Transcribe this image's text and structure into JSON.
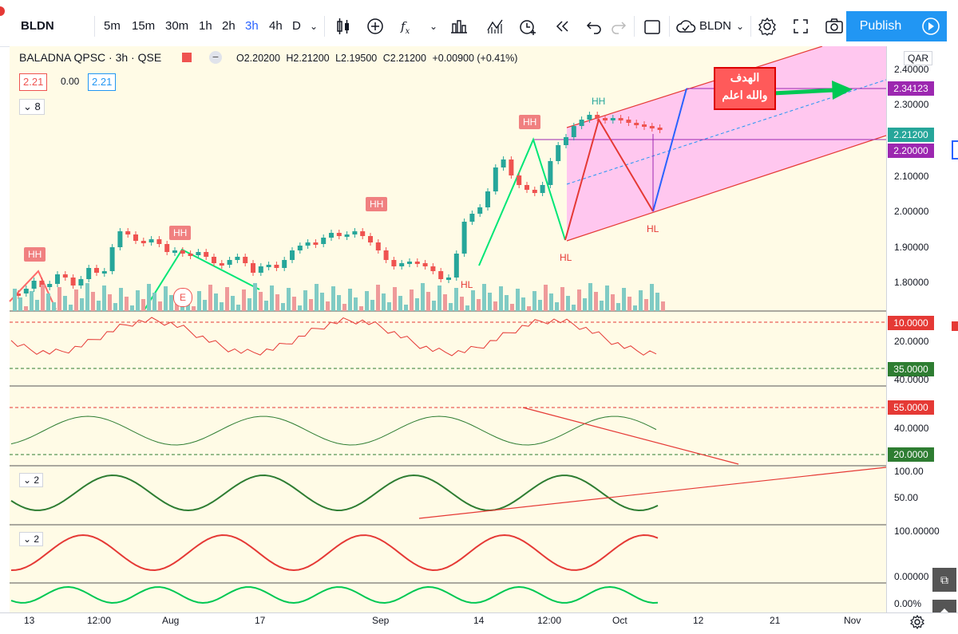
{
  "toolbar": {
    "symbol": "BLDN",
    "intervals": [
      "5m",
      "15m",
      "30m",
      "1h",
      "2h",
      "3h",
      "4h",
      "D"
    ],
    "active_interval": "3h",
    "compare_symbol": "BLDN",
    "publish_label": "Publish"
  },
  "legend": {
    "title": "BALADNA QPSC · 3h · QSE",
    "open": "O2.20200",
    "high": "H2.21200",
    "low": "L2.19500",
    "close": "C2.21200",
    "change": "+0.00900 (+0.41%)",
    "bid": "2.21",
    "spread": "0.00",
    "ask": "2.21",
    "indicators_count": "8"
  },
  "price_axis": {
    "currency": "QAR",
    "ticks": [
      "2.40000",
      "2.30000",
      "2.20000",
      "2.10000",
      "2.00000",
      "1.90000",
      "1.80000"
    ],
    "badge_target": "2.34123",
    "badge_last": "2.21200",
    "badge_line": "2.20000"
  },
  "annotations": {
    "hh": [
      "HH",
      "HH",
      "HH",
      "HH",
      "HH"
    ],
    "hl": [
      "HL",
      "HL",
      "HL"
    ],
    "target_line1": "الهدف",
    "target_line2": "والله اعلم",
    "marker_e": "E"
  },
  "pane2": {
    "ticks": [
      "20.0000",
      "40.0000"
    ],
    "badge_top": "10.0000",
    "badge_bottom": "35.0000"
  },
  "pane3": {
    "ticks": [
      "40.0000"
    ],
    "badge_top": "55.0000",
    "badge_bottom": "20.0000"
  },
  "pane4": {
    "ticks": [
      "100.00",
      "50.00"
    ],
    "count": "2"
  },
  "pane5": {
    "ticks": [
      "100.00000",
      "0.00000"
    ],
    "count": "2"
  },
  "pane6": {
    "ticks": [
      "0.00%"
    ]
  },
  "time_axis": [
    "13",
    "12:00",
    "Aug",
    "17",
    "Sep",
    "14",
    "12:00",
    "Oct",
    "12",
    "21",
    "Nov"
  ],
  "colors": {
    "up": "#26a69a",
    "down": "#ef5350",
    "channel": "#ff66ff",
    "accent": "#2962ff"
  }
}
